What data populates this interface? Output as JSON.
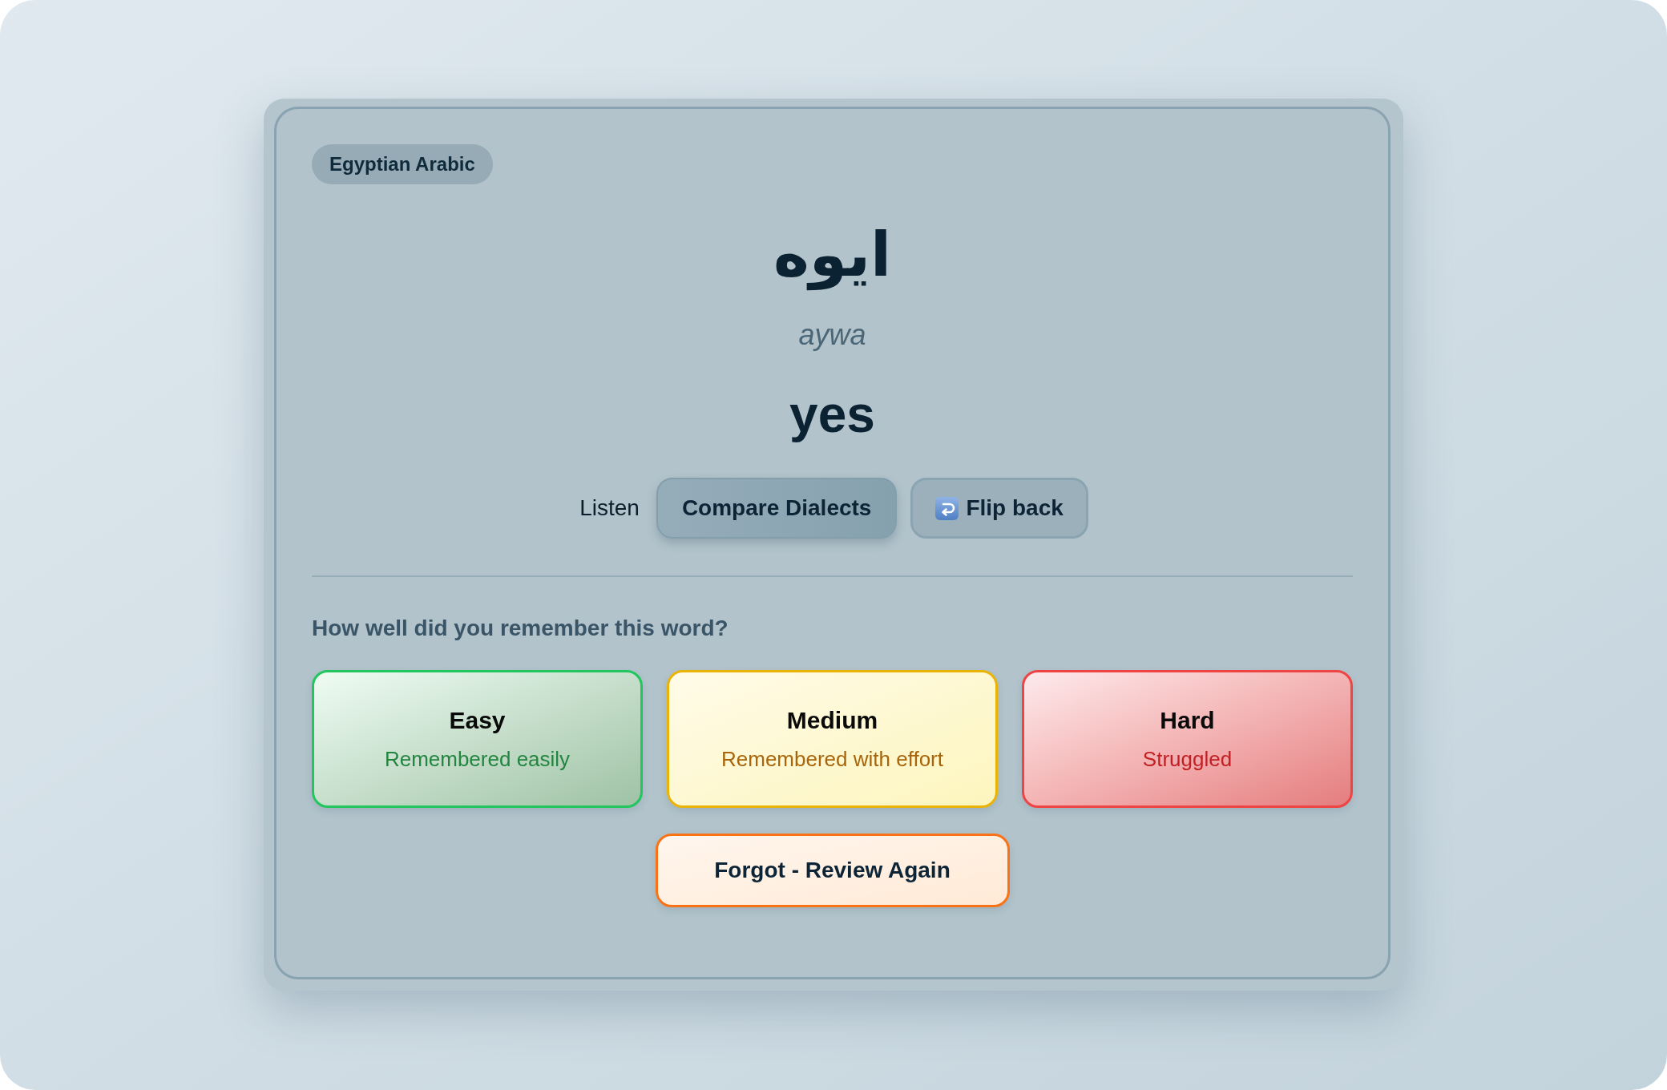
{
  "card": {
    "badge": "Egyptian Arabic",
    "word": "ايوه",
    "transliteration": "aywa",
    "translation": "yes"
  },
  "actions": [
    {
      "kind": "plain",
      "label": "Listen"
    },
    {
      "kind": "filled",
      "label": "Compare Dialects"
    },
    {
      "kind": "flip",
      "label": "Flip back"
    }
  ],
  "review": {
    "question": "How well did you remember this word?",
    "ratings": [
      {
        "kind": "easy",
        "label": "Easy",
        "description": "Remembered easily"
      },
      {
        "kind": "medium",
        "label": "Medium",
        "description": "Remembered with effort"
      },
      {
        "kind": "hard",
        "label": "Hard",
        "description": "Struggled"
      }
    ],
    "forgot": {
      "label": "Forgot - Review Again"
    }
  }
}
